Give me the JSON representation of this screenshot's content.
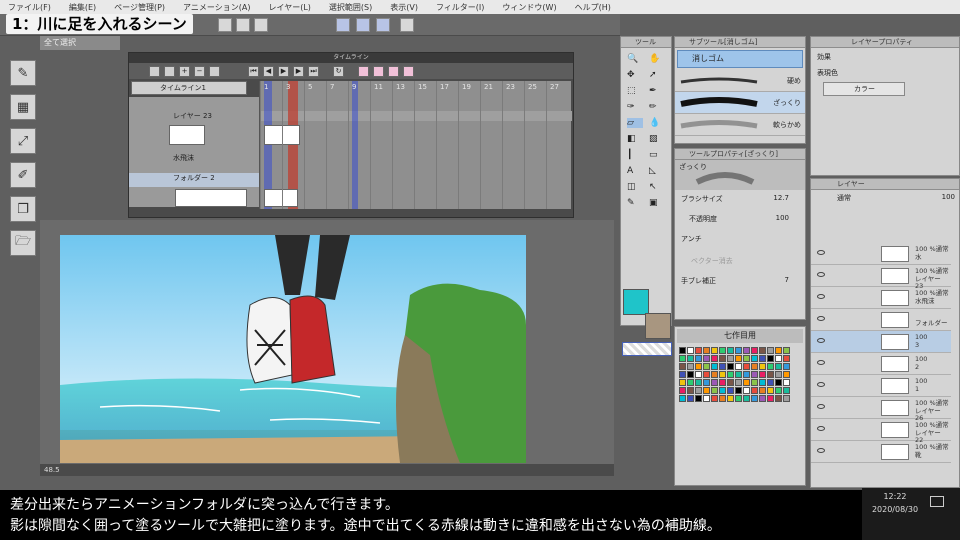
{
  "video_title": "1：川に足を入れるシーン",
  "menu": [
    "ファイル(F)",
    "編集(E)",
    "ページ管理(P)",
    "アニメーション(A)",
    "レイヤー(L)",
    "選択範囲(S)",
    "表示(V)",
    "フィルター(I)",
    "ウィンドウ(W)",
    "ヘルプ(H)"
  ],
  "doc_tab": "全て選択",
  "timeline": {
    "title": "タイムライン",
    "selector": "タイムライン1",
    "frame_numbers": [
      "1",
      "3",
      "5",
      "7",
      "9",
      "11",
      "13",
      "15",
      "17",
      "19",
      "21",
      "23",
      "25",
      "27"
    ],
    "rows": [
      {
        "label": "レイヤー 23"
      },
      {
        "label": "水飛沫"
      },
      {
        "label": "フォルダー 2"
      }
    ]
  },
  "canvas": {
    "zoom": "48.5"
  },
  "tool_panel": {
    "title": "ツール"
  },
  "subtool_panel": {
    "title": "サブツール[消しゴム]",
    "active": "消しゴム",
    "items": [
      "硬め",
      "ざっくり",
      "軟らかめ"
    ]
  },
  "tool_property": {
    "title": "ツールプロパティ[ざっくり]",
    "preset": "ざっくり",
    "brush_size_label": "ブラシサイズ",
    "brush_size": "12.7",
    "opacity_label": "不透明度",
    "opacity": "100",
    "aa_label": "アンチ",
    "vector_label": "ベクター消去",
    "stabilize_label": "手ブレ補正",
    "stabilize": "7"
  },
  "color_set": {
    "title": "七作目用"
  },
  "layer_property": {
    "title": "レイヤープロパティ",
    "effect_label": "効果",
    "expression_label": "表現色",
    "expression_value": "カラー"
  },
  "layer_panel": {
    "title": "レイヤー",
    "blend": "通常",
    "opacity": "100",
    "layers": [
      {
        "pct": "100 %通常",
        "name": "水"
      },
      {
        "pct": "100 %通常",
        "name": "レイヤー 23"
      },
      {
        "pct": "100 %通常",
        "name": "水飛沫"
      },
      {
        "pct": "",
        "name": "フォルダー"
      },
      {
        "pct": "100",
        "name": "3"
      },
      {
        "pct": "100",
        "name": "2"
      },
      {
        "pct": "100",
        "name": "1"
      },
      {
        "pct": "100 %通常",
        "name": "レイヤー 26"
      },
      {
        "pct": "100 %通常",
        "name": "レイヤー 22"
      },
      {
        "pct": "100 %通常",
        "name": "靴"
      }
    ]
  },
  "subtitles": {
    "line1": "差分出来たらアニメーションフォルダに突っ込んで行きます。",
    "line2": "影は隙間なく囲って塗るツールで大雑把に塗ります。途中で出てくる赤線は動きに違和感を出さない為の補助線。"
  },
  "clock": {
    "time": "12:22",
    "date": "2020/08/30"
  },
  "colors": {
    "accent_blue": "#3a4fcf",
    "red_guide": "#c0392b",
    "cyan": "#1fc4c9"
  }
}
